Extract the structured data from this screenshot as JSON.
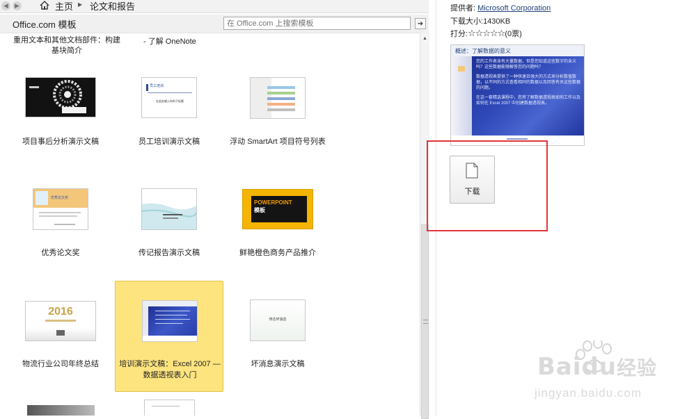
{
  "nav": {
    "breadcrumb": [
      "主页",
      "论文和报告"
    ]
  },
  "templates_bar": {
    "title": "Office.com 模板",
    "search_placeholder": "在 Office.com 上搜索模板"
  },
  "top_partial_items": [
    {
      "label": "重用文本和其他文档部件：构建",
      "label2": "基块简介"
    },
    {
      "label": "- 了解 OneNote"
    }
  ],
  "templates": [
    {
      "label": "项目事后分析演示文稿"
    },
    {
      "label": "员工培训演示文稿",
      "thumb_title": "员工培训",
      "thumb_sub": "在此处输入你的子标题"
    },
    {
      "label": "浮动 SmartArt 项目符号列表"
    },
    {
      "label": "优秀论文奖",
      "thumb_title": "优秀论文奖"
    },
    {
      "label": "传记报告演示文稿"
    },
    {
      "label": "鲜艳橙色商务产品推介",
      "thumb_title": "POWERPOINT",
      "thumb_sub": "模板"
    },
    {
      "label": "物流行业公司年终总结",
      "thumb_title": "2016"
    },
    {
      "label": "培训演示文稿：Excel 2007 —",
      "label2": "数据透视表入门",
      "selected": true
    },
    {
      "label": "坏消息演示文稿",
      "thumb_title": "传达坏消息"
    }
  ],
  "details": {
    "provider_label": "提供者:",
    "provider": "Microsoft Corporation",
    "size_label": "下载大小:",
    "size": "1430KB",
    "rating_label": "打分:",
    "stars": "☆☆☆☆☆",
    "votes": "(0票)",
    "rating_value": 0,
    "preview": {
      "title": "概述：了解数据的意义",
      "paragraphs": [
        "您的工作表含有大量数据，但是您知道这些数字的含义吗？这些数据能够解答您的问题吗？",
        "数据透视表提供了一种快速且强大的方式来分析数值数据，以不同的方式查看相同的数据以及回答有关这些数据的问题。",
        "在这一套精选课程中，您将了解数据透视表如何工作以及如何在 Excel 2007 中创建数据透视表。"
      ]
    },
    "download_label": "下载"
  },
  "watermark": {
    "brand": "Baidu",
    "brand2": "经验",
    "url": "jingyan.baidu.com"
  },
  "colors": {
    "highlight": "#fde47f",
    "annotation": "#e0343a",
    "preview_blue": "#2a3ea8",
    "link": "#1f3f7a"
  }
}
